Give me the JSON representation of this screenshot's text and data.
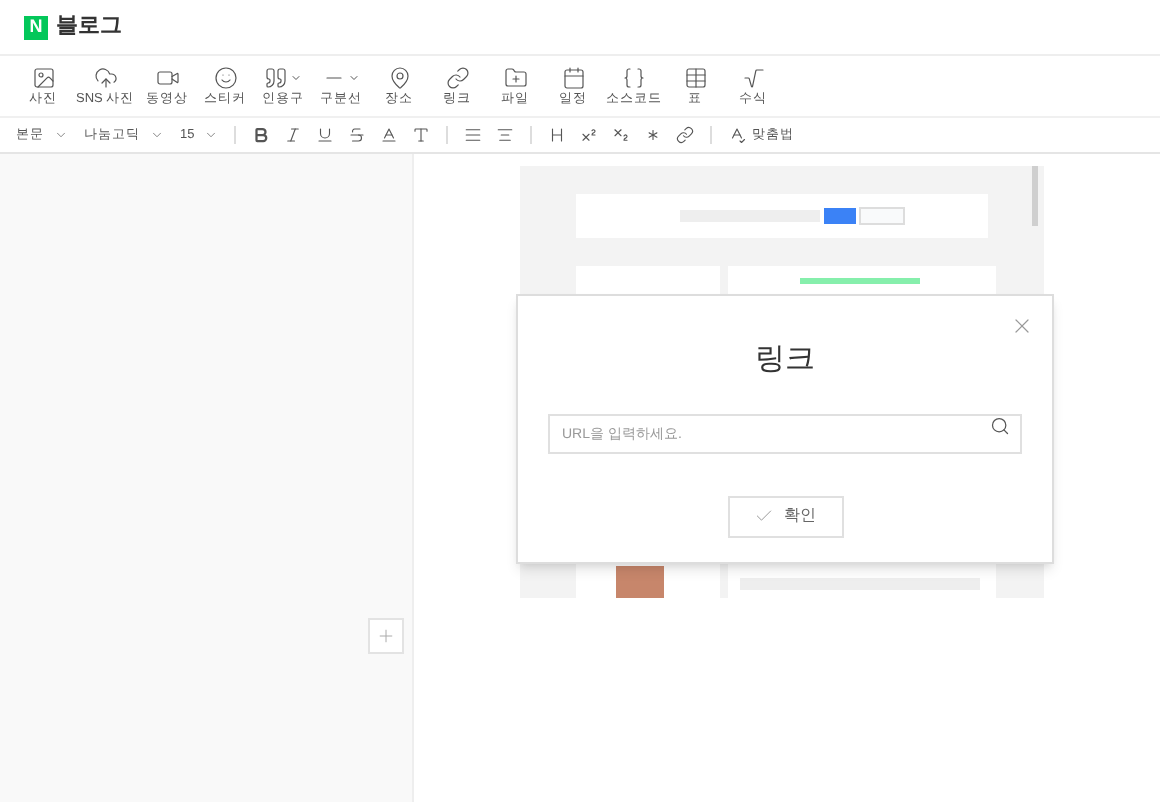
{
  "header": {
    "logo_letter": "N",
    "title": "블로그"
  },
  "insert_toolbar": [
    {
      "label": "사진",
      "has_menu": false
    },
    {
      "kind": "cloud",
      "label": "SNS 사진",
      "has_menu": false
    },
    {
      "kind": "video",
      "label": "동영상",
      "has_menu": false
    },
    {
      "kind": "sticker",
      "label": "스티커",
      "has_menu": false
    },
    {
      "kind": "quote",
      "label": "인용구",
      "has_menu": true
    },
    {
      "kind": "divider",
      "label": "구분선",
      "has_menu": true
    },
    {
      "kind": "place",
      "label": "장소",
      "has_menu": false
    },
    {
      "kind": "link",
      "label": "링크",
      "has_menu": false
    },
    {
      "kind": "file",
      "label": "파일",
      "has_menu": false
    },
    {
      "kind": "schedule",
      "label": "일정",
      "has_menu": false
    },
    {
      "kind": "code",
      "label": "소스코드",
      "has_menu": false
    },
    {
      "kind": "table",
      "label": "표",
      "has_menu": false
    },
    {
      "kind": "formula",
      "label": "수식",
      "has_menu": false
    }
  ],
  "format_toolbar": {
    "dropdowns": [
      "본문",
      "나눔고딕",
      "15"
    ],
    "groups": [
      {
        "buttons": [
          {
            "kind": "bold"
          },
          {
            "kind": "italic"
          },
          {
            "kind": "underline"
          },
          {
            "kind": "strike"
          },
          {
            "kind": "color"
          },
          {
            "kind": "background"
          }
        ]
      },
      {
        "buttons": [
          {
            "kind": "align"
          },
          {
            "kind": "linespace"
          }
        ]
      },
      {
        "buttons": [
          {
            "kind": "linespace2"
          },
          {
            "kind": "superscript"
          },
          {
            "kind": "subscript"
          },
          {
            "kind": "special"
          },
          {
            "kind": "link"
          }
        ]
      }
    ],
    "spellcheck": "맞춤법"
  },
  "link_dialog": {
    "title": "링크",
    "url_field": {
      "placeholder": "URL을 입력하세요."
    },
    "confirm_button": "확인"
  }
}
